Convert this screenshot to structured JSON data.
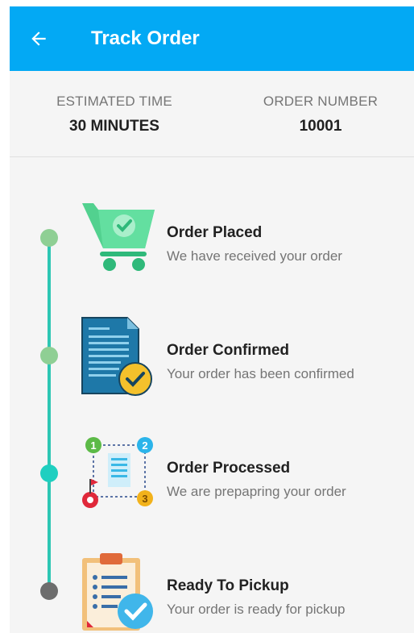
{
  "appbar": {
    "title": "Track Order",
    "back_icon": "arrow-back-icon",
    "color": "#03a9f4"
  },
  "info": {
    "estimated_time_label": "ESTIMATED TIME",
    "estimated_time_value": "30 MINUTES",
    "order_number_label": "ORDER NUMBER",
    "order_number_value": "10001"
  },
  "steps": [
    {
      "title": "Order Placed",
      "subtitle": "We have received your order",
      "icon": "shopping-cart-check-icon",
      "dot_color": "#8fcf94",
      "status": "completed"
    },
    {
      "title": "Order Confirmed",
      "subtitle": "Your order has been confirmed",
      "icon": "document-check-icon",
      "dot_color": "#8fcf94",
      "status": "completed"
    },
    {
      "title": "Order Processed",
      "subtitle": "We are prepapring your order",
      "icon": "process-route-icon",
      "dot_color": "#1fcfc0",
      "status": "current"
    },
    {
      "title": "Ready To Pickup",
      "subtitle": "Your order is ready for pickup",
      "icon": "clipboard-check-icon",
      "dot_color": "#6d6d6d",
      "status": "pending"
    }
  ],
  "colors": {
    "timeline": "#2ec7b4"
  }
}
